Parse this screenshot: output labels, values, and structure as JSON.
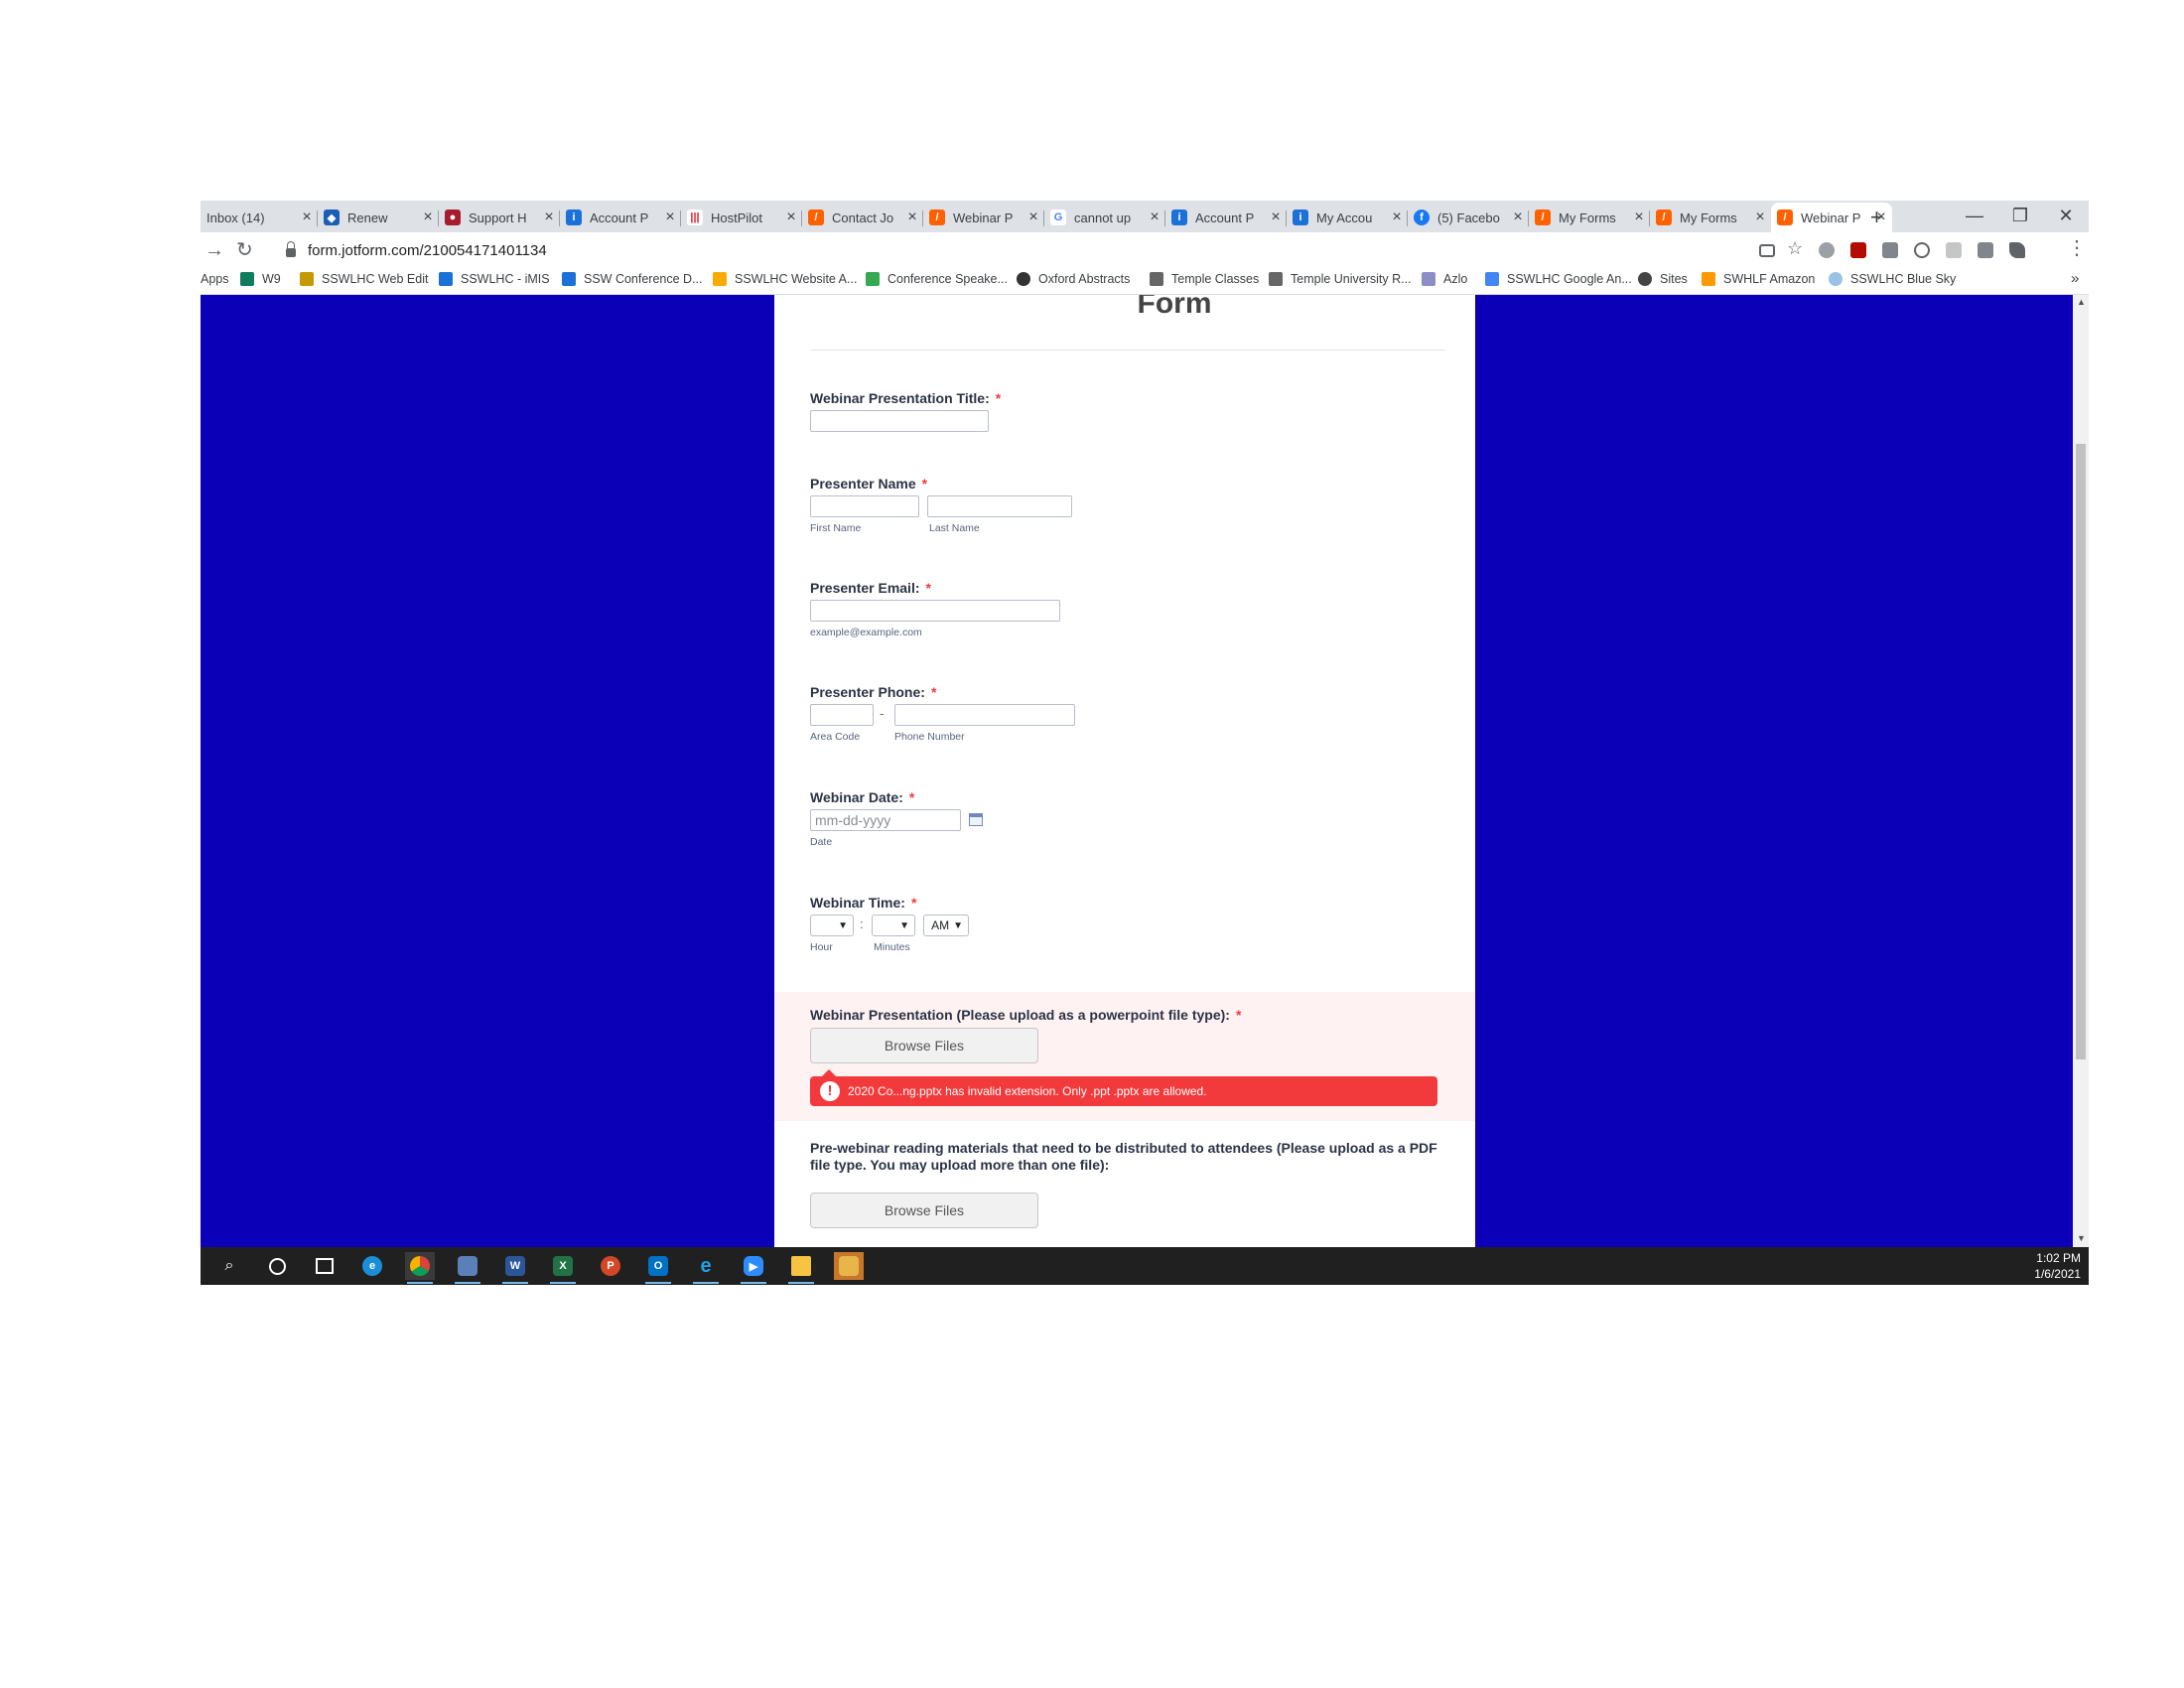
{
  "browser": {
    "tabs": [
      {
        "title": "Inbox (14)",
        "color": "#c5221f"
      },
      {
        "title": "Renew",
        "color": "#1a5fb4"
      },
      {
        "title": "Support H",
        "color": "#a51d2d"
      },
      {
        "title": "Account P",
        "color": "#1c71d8"
      },
      {
        "title": "HostPilot",
        "color": "#e01b24"
      },
      {
        "title": "Contact Jo",
        "color": "#ff6100"
      },
      {
        "title": "Webinar P",
        "color": "#ff6100"
      },
      {
        "title": "cannot up",
        "color": "#4285f4"
      },
      {
        "title": "Account P",
        "color": "#1c71d8"
      },
      {
        "title": "My Accou",
        "color": "#1c71d8"
      },
      {
        "title": "(5) Facebo",
        "color": "#1877f2"
      },
      {
        "title": "My Forms",
        "color": "#ff6100"
      },
      {
        "title": "My Forms",
        "color": "#ff6100"
      },
      {
        "title": "Webinar P",
        "color": "#ff6100"
      }
    ],
    "new_tab": "+",
    "window_controls": {
      "minimize": "—",
      "restore": "❐",
      "close": "✕"
    },
    "nav": {
      "forward": "→",
      "reload": "↻"
    },
    "url": "form.jotform.com/210054171401134",
    "bookmarks": [
      {
        "label": "Apps",
        "color": "#4285f4"
      },
      {
        "label": "W9",
        "color": "#0f7b5f"
      },
      {
        "label": "SSWLHC Web Edit",
        "color": "#c49a00"
      },
      {
        "label": "SSWLHC - iMIS",
        "color": "#1c71d8"
      },
      {
        "label": "SSW Conference D...",
        "color": "#1c71d8"
      },
      {
        "label": "SSWLHC Website A...",
        "color": "#f9ab00"
      },
      {
        "label": "Conference Speake...",
        "color": "#34a853"
      },
      {
        "label": "Oxford Abstracts",
        "color": "#333333"
      },
      {
        "label": "Temple Classes",
        "color": "#666666"
      },
      {
        "label": "Temple University R...",
        "color": "#666666"
      },
      {
        "label": "Azlo",
        "color": "#8e8ec7"
      },
      {
        "label": "SSWLHC Google An...",
        "color": "#4285f4"
      },
      {
        "label": "Sites",
        "color": "#444444"
      },
      {
        "label": "SWHLF Amazon",
        "color": "#ff9900"
      },
      {
        "label": "SSWLHC Blue Sky",
        "color": "#9ac1e6"
      }
    ],
    "bookmarks_overflow": "»"
  },
  "form": {
    "title": "Form",
    "fields": {
      "title_label": "Webinar Presentation Title:",
      "name_label": "Presenter Name",
      "first_name": "First Name",
      "last_name": "Last Name",
      "email_label": "Presenter Email:",
      "email_hint": "example@example.com",
      "phone_label": "Presenter Phone:",
      "phone_dash": "-",
      "area_code": "Area Code",
      "phone_number": "Phone Number",
      "date_label": "Webinar Date:",
      "date_placeholder": "mm-dd-yyyy",
      "date_sub": "Date",
      "time_label": "Webinar Time:",
      "time_colon": ":",
      "hour": "Hour",
      "minutes": "Minutes",
      "ampm_value": "AM",
      "upload_label": "Webinar Presentation (Please upload as a powerpoint file type):",
      "browse_label": "Browse Files",
      "error_text": "2020 Co...ng.pptx has invalid extension. Only .ppt .pptx are allowed.",
      "error_icon": "!",
      "reading_label": "Pre-webinar reading materials that need to be distributed to attendees (Please upload as a PDF file type. You may upload more than one file):",
      "reading_browse": "Browse Files"
    },
    "required_mark": "*"
  },
  "taskbar": {
    "time": "1:02 PM",
    "date": "1/6/2021"
  },
  "colors": {
    "page_background": "#0b00b8",
    "error": "#f23a3c",
    "upload_highlight": "#fff2f2"
  }
}
